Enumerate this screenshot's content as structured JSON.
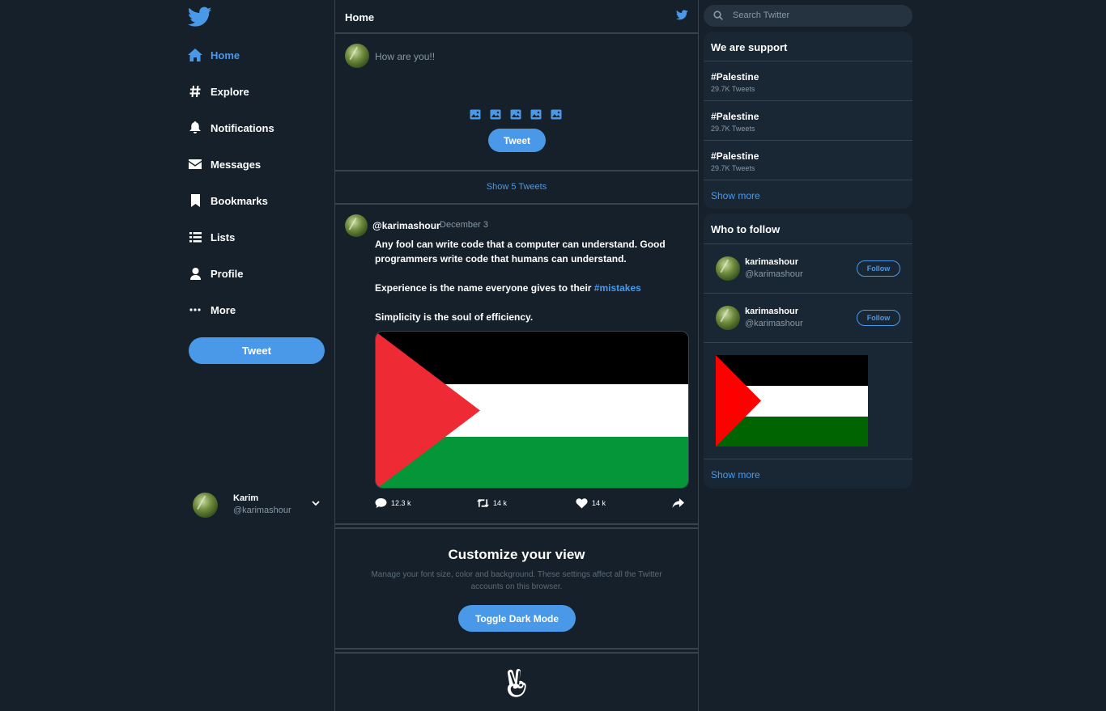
{
  "sidebar": {
    "nav": [
      {
        "label": "Home",
        "icon": "home-icon"
      },
      {
        "label": "Explore",
        "icon": "hashtag-icon"
      },
      {
        "label": "Notifications",
        "icon": "bell-icon"
      },
      {
        "label": "Messages",
        "icon": "envelope-icon"
      },
      {
        "label": "Bookmarks",
        "icon": "bookmark-icon"
      },
      {
        "label": "Lists",
        "icon": "list-icon"
      },
      {
        "label": "Profile",
        "icon": "user-icon"
      },
      {
        "label": "More",
        "icon": "more-icon"
      }
    ],
    "tweet_label": "Tweet",
    "profile": {
      "name": "Karim",
      "handle": "@karimashour"
    }
  },
  "center": {
    "header_title": "Home",
    "composer": {
      "placeholder": "How are you!!",
      "tweet_label": "Tweet"
    },
    "show_tweets": "Show 5 Tweets",
    "tweet": {
      "handle": "@karimashour",
      "date": ".December 3",
      "line1": "Any fool can write code that a computer can understand. Good programmers write code that humans can understand.",
      "line2_prefix": "Experience is the name everyone gives to their ",
      "line2_hashtag": "#mistakes",
      "line3": "Simplicity is the soul of efficiency.",
      "replies": "12.3 k",
      "retweets": "14 k",
      "likes": "14 k"
    },
    "customize": {
      "title": "Customize your view",
      "desc": "Manage your font size, color and background. These settings affect all the Twitter accounts on this browser.",
      "button": "Toggle Dark Mode"
    }
  },
  "right": {
    "search_placeholder": "Search Twitter",
    "trends_title": "We are support",
    "trends": [
      {
        "name": "#Palestine",
        "count": "29.7K Tweets"
      },
      {
        "name": "#Palestine",
        "count": "29.7K Tweets"
      },
      {
        "name": "#Palestine",
        "count": "29.7K Tweets"
      }
    ],
    "show_more": "Show more",
    "follow_title": "Who to follow",
    "follow": [
      {
        "name": "karimashour",
        "handle": "@karimashour",
        "button": "Follow"
      },
      {
        "name": "karimashour",
        "handle": "@karimashour",
        "button": "Follow"
      }
    ],
    "show_more_2": "Show more"
  },
  "colors": {
    "accent": "#4a99e9",
    "background": "#15202b",
    "card": "#192734",
    "border": "#38444d"
  }
}
